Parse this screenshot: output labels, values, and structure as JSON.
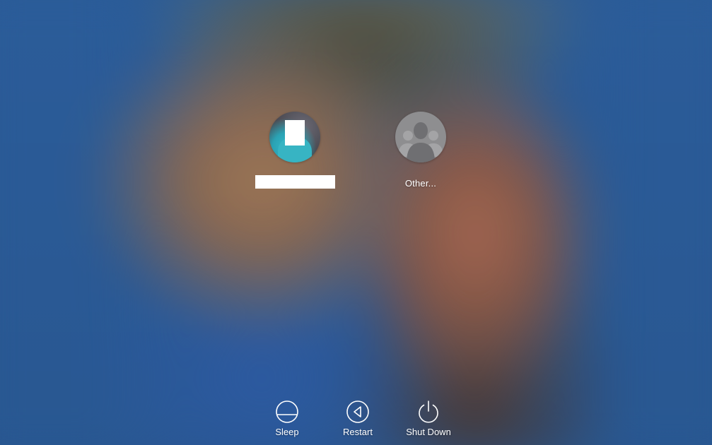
{
  "login_window": {
    "users": [
      {
        "name": "",
        "avatar": "user-photo",
        "name_redacted": true
      },
      {
        "name": "Other...",
        "avatar": "generic-users-icon"
      }
    ],
    "power_controls": [
      {
        "label": "Sleep",
        "icon": "sleep-icon"
      },
      {
        "label": "Restart",
        "icon": "restart-icon"
      },
      {
        "label": "Shut Down",
        "icon": "power-icon"
      }
    ]
  },
  "colors": {
    "background": "#2a5b97",
    "text": "#ffffff",
    "avatar_other": "#8e8e90"
  }
}
